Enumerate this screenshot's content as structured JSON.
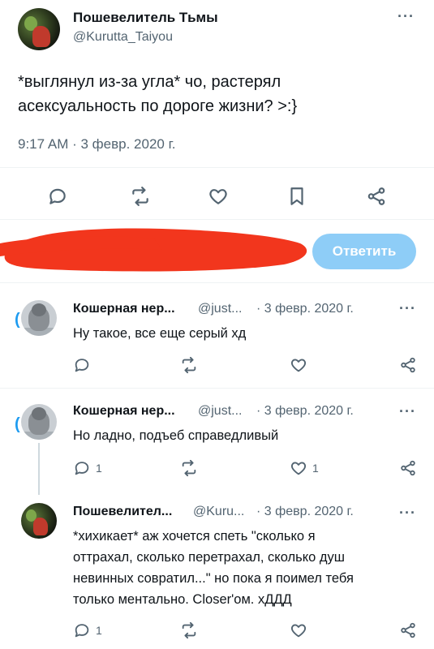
{
  "main_tweet": {
    "author_name": "Пошевелитель Тьмы",
    "author_handle": "@Kurutta_Taiyou",
    "text_line1": "*выглянул из-за угла* чо, растерял",
    "text_line2": "асексуальность по дороге жизни? >:}",
    "timestamp": "9:17 AM · 3 февр. 2020 г.",
    "more_icon": "more-horizontal-icon",
    "actions": [
      "reply-icon",
      "retweet-icon",
      "like-icon",
      "bookmark-icon",
      "share-icon"
    ]
  },
  "composer": {
    "reply_button_label": "Ответить",
    "redaction_color": "#f2361d",
    "button_color": "#8ecdf7"
  },
  "replies": [
    {
      "author_name": "Кошерная нер...",
      "author_handle": "@just...",
      "date": "· 3 февр. 2020 г.",
      "text": "Ну такое, все еще серый хд",
      "reply_count": "",
      "like_count": ""
    },
    {
      "author_name": "Кошерная нер...",
      "author_handle": "@just...",
      "date": "· 3 февр. 2020 г.",
      "text": "Но ладно, подъеб справедливый",
      "reply_count": "1",
      "like_count": "1"
    },
    {
      "author_name": "Пошевелител...",
      "author_handle": "@Kuru...",
      "date": "· 3 февр. 2020 г.",
      "text_lines": [
        "*хихикает* аж хочется спеть \"сколько я",
        "оттрахал, сколько перетрахал, сколько душ",
        "невинных совратил...\" но пока я поимел тебя",
        "только ментально. Closer'ом. хДДД"
      ],
      "reply_count": "1",
      "like_count": ""
    }
  ],
  "colors": {
    "text_primary": "#0f1419",
    "text_secondary": "#536471",
    "accent": "#1d9bf0",
    "divider": "#eff3f4"
  }
}
